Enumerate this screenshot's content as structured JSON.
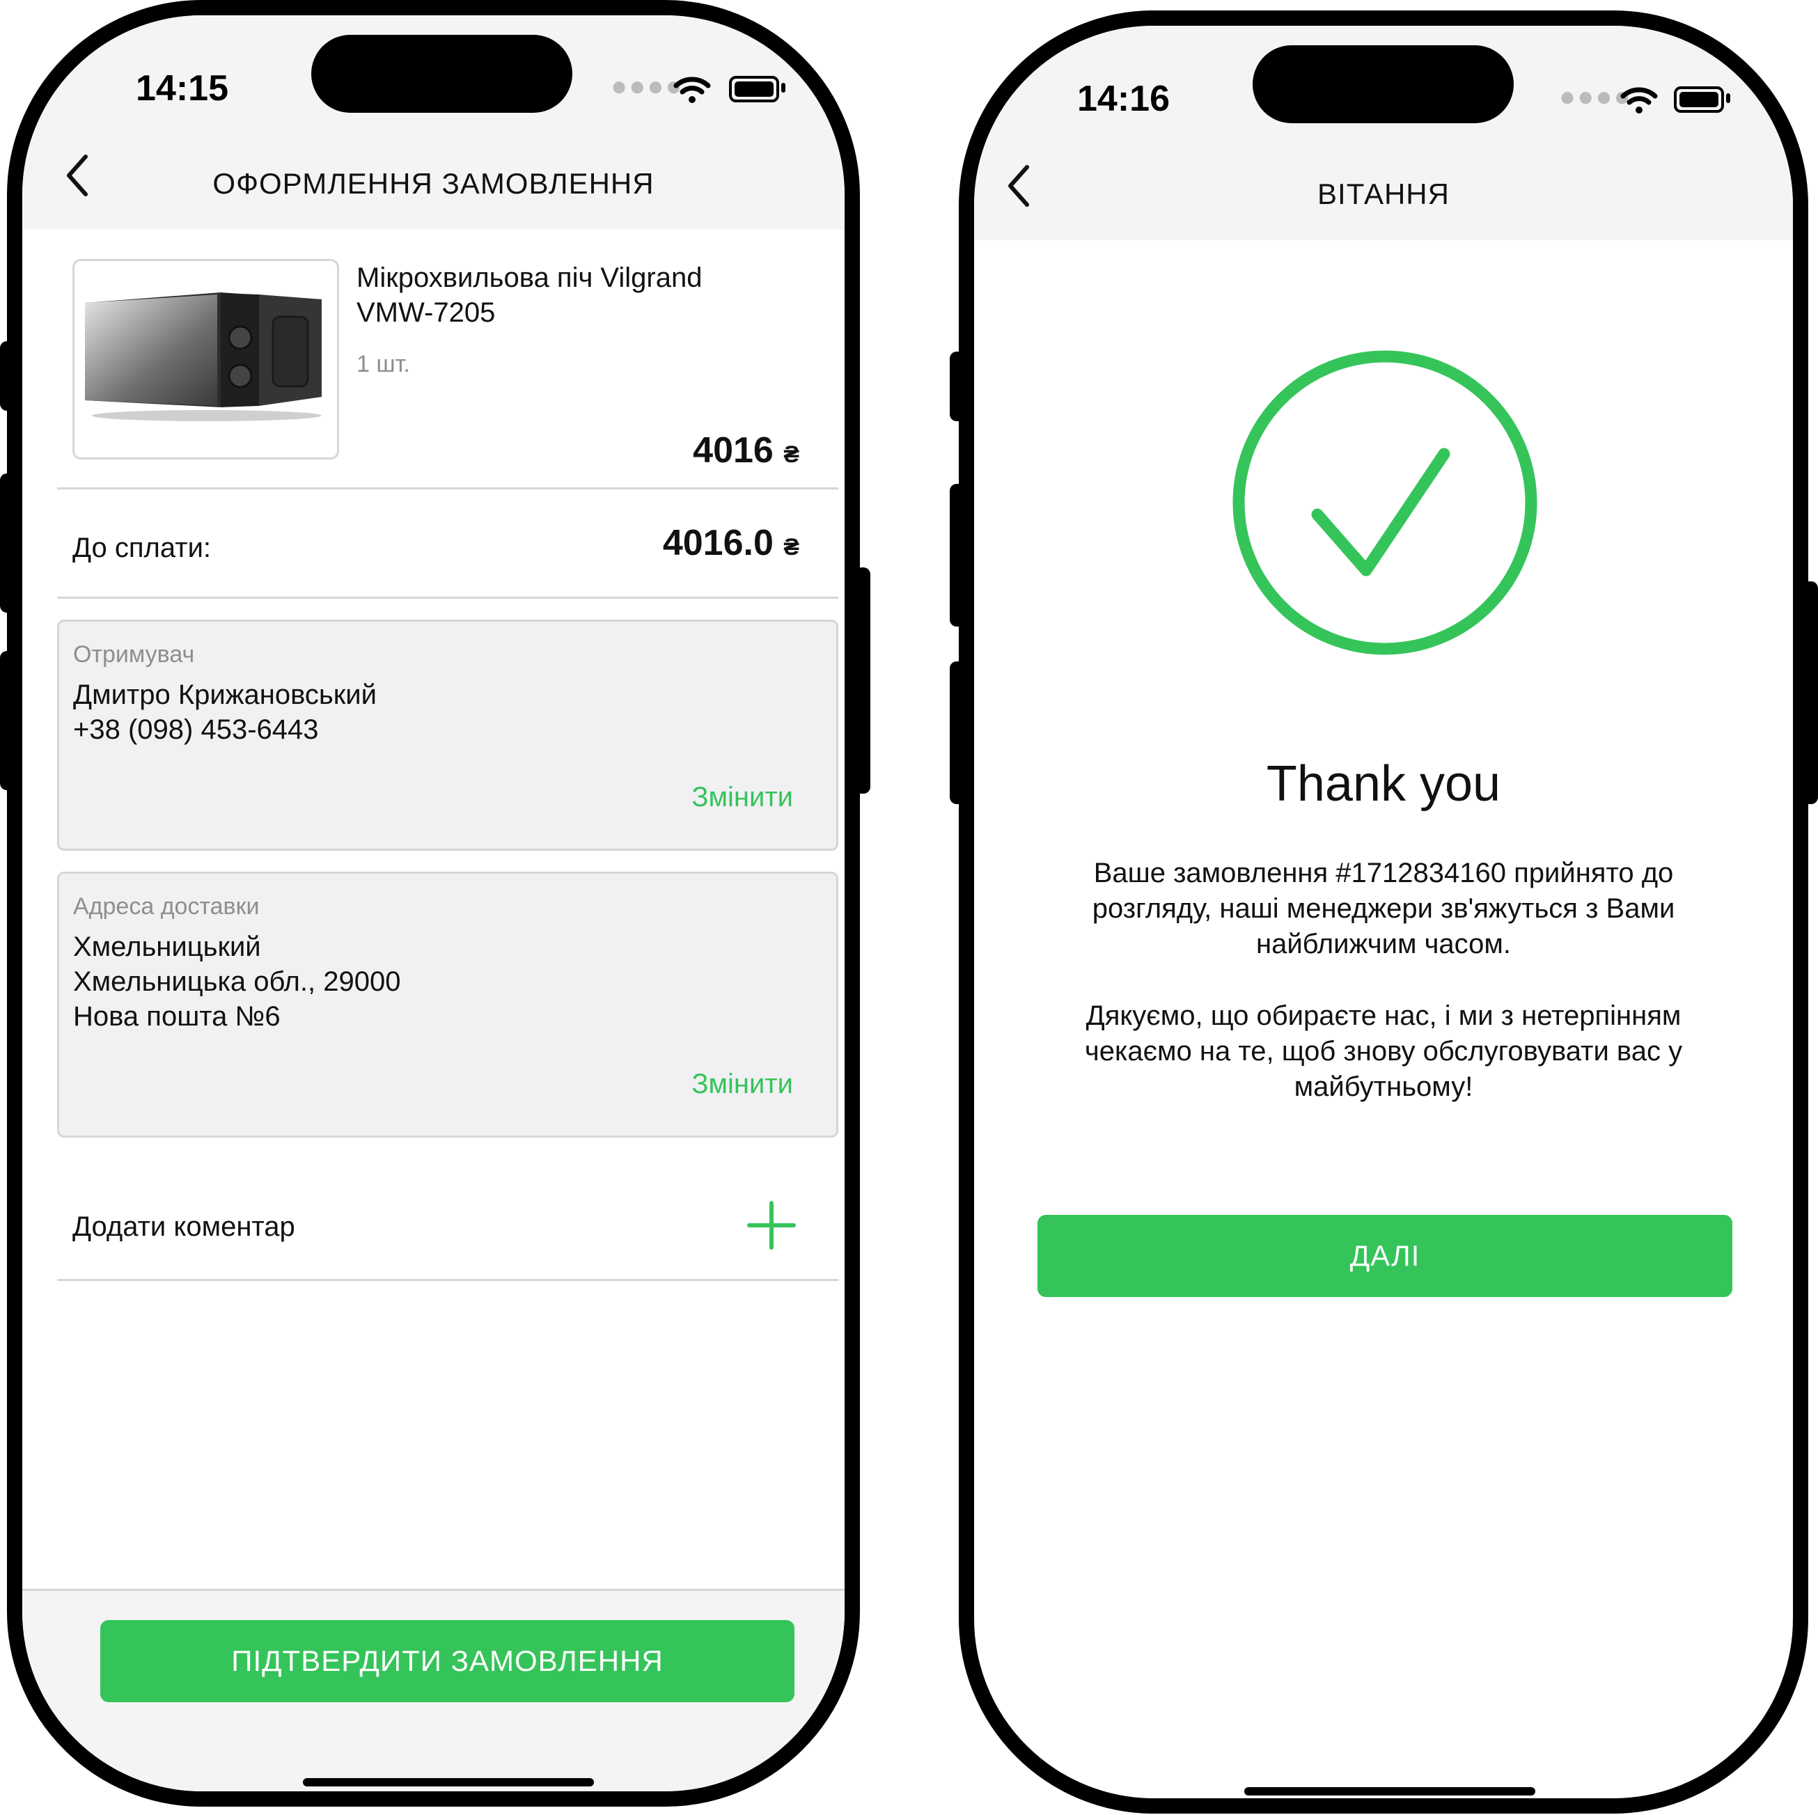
{
  "left": {
    "status": {
      "time": "14:15"
    },
    "nav": {
      "title": "ОФОРМЛЕННЯ ЗАМОВЛЕННЯ"
    },
    "product": {
      "name_line1": "Мікрохвильова піч Vilgrand",
      "name_line2": "VMW-7205",
      "qty": "1 шт.",
      "price": "4016",
      "currency": "₴"
    },
    "total": {
      "label": "До сплати:",
      "amount": "4016.0",
      "currency": "₴"
    },
    "recipient": {
      "label": "Отримувач",
      "name": "Дмитро Крижановський",
      "phone": "+38 (098) 453-6443",
      "change": "Змінити"
    },
    "address": {
      "label": "Адреса доставки",
      "line1": "Хмельницький",
      "line2": "Хмельницька обл., 29000",
      "line3": "Нова пошта №6",
      "change": "Змінити"
    },
    "comment": {
      "label": "Додати коментар"
    },
    "confirm_button": "ПІДТВЕРДИТИ ЗАМОВЛЕННЯ"
  },
  "right": {
    "status": {
      "time": "14:16"
    },
    "nav": {
      "title": "ВІТАННЯ"
    },
    "heading": "Thank you",
    "message_line1": "Ваше замовлення #1712834160 прийнято до",
    "message_line2": "розгляду, наші менеджери зв'яжуться з Вами",
    "message_line3": "найближчим часом.",
    "thanks_line1": "Дякуємо, що обираєте нас, і ми з нетерпінням",
    "thanks_line2": "чекаємо на те, щоб знову обслуговувати вас у",
    "thanks_line3": "майбутньому!",
    "next_button": "ДАЛІ"
  },
  "colors": {
    "accent": "#35c45a",
    "card_bg": "#f1f1f4",
    "bar_bg": "#f4f4f4"
  },
  "icons": [
    "back-chevron-icon",
    "wifi-icon",
    "battery-icon",
    "plus-icon",
    "success-check-icon",
    "microwave-image"
  ]
}
